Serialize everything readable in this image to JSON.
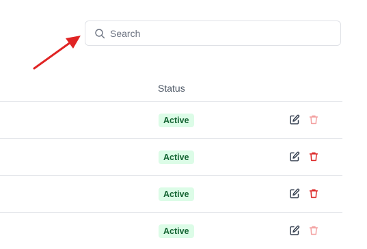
{
  "search": {
    "placeholder": "Search",
    "value": ""
  },
  "table": {
    "columns": [
      "Status"
    ],
    "rows": [
      {
        "status": "Active",
        "delete_muted": true
      },
      {
        "status": "Active",
        "delete_muted": false
      },
      {
        "status": "Active",
        "delete_muted": false
      },
      {
        "status": "Active",
        "delete_muted": true
      }
    ]
  },
  "icons": {
    "search": "search-icon",
    "edit": "edit-icon",
    "delete": "trash-icon"
  },
  "colors": {
    "badge_bg": "#dcfce7",
    "badge_text": "#166534",
    "delete_active": "#dc2626",
    "delete_muted": "#f3a0a0",
    "edit": "#374151",
    "annotation_arrow": "#e02424"
  }
}
